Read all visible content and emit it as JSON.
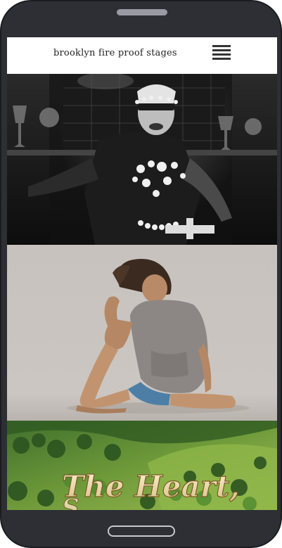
{
  "header": {
    "site_title": "brooklyn fire proof stages"
  },
  "tiles": [
    {
      "caption": ""
    },
    {
      "caption": ""
    },
    {
      "caption": "The Heart,"
    }
  ],
  "colors": {
    "device_body": "#2e2f35",
    "screen_bg": "#ffffff",
    "menu_icon": "#333333",
    "speaker": "#9a9aa2"
  },
  "icons": {
    "menu": "hamburger-menu-icon"
  }
}
